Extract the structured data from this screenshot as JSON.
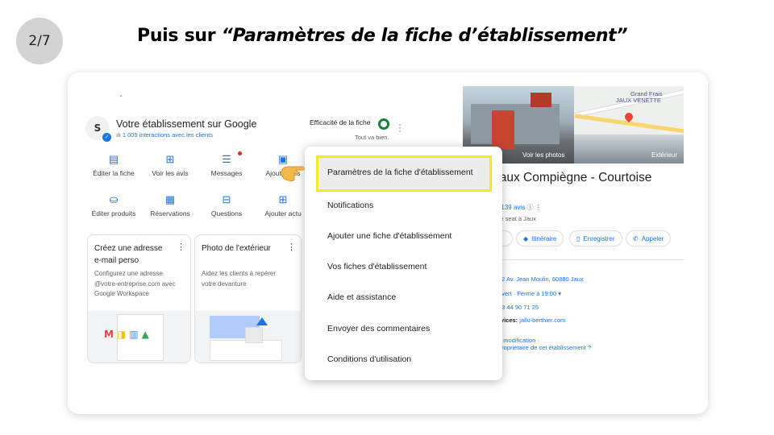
{
  "slide": {
    "step": "2/7",
    "title_prefix": "Puis sur ",
    "title_quoted": "“Paramètres de la fiche d’établissement”"
  },
  "business": {
    "title": "Votre établissement sur Google",
    "interactions": "1 009 interactions avec les clients",
    "efficiency_label": "Efficacité de la fiche",
    "efficiency_status": "Tout va bien."
  },
  "actions": [
    {
      "label": "Éditer la fiche",
      "icon": "storefront-icon"
    },
    {
      "label": "Voir les avis",
      "icon": "review-icon"
    },
    {
      "label": "Messages",
      "icon": "message-icon"
    },
    {
      "label": "Ajouter des",
      "icon": "add-photo-icon"
    },
    {
      "label": "Éditer produits",
      "icon": "shopping-bag-icon"
    },
    {
      "label": "Réservations",
      "icon": "calendar-icon"
    },
    {
      "label": "Questions",
      "icon": "question-icon"
    },
    {
      "label": "Ajouter actu",
      "icon": "add-post-icon"
    }
  ],
  "cards": [
    {
      "title": "Créez une adresse e-mail perso",
      "description": "Configurez une adresse @votre-entreprise.com avec Google Workspace"
    },
    {
      "title": "Photo de l'extérieur",
      "description": "Aidez les clients à repérer votre devanture"
    }
  ],
  "knowledge_panel": {
    "photos_label": "Voir les photos",
    "exterior_label": "Extérieur",
    "map_label_1": "Grand Frais",
    "map_label_2": "JAUX VENETTE",
    "name_line1": "Jaux Compiègne - Courtoise",
    "name_line2": "s",
    "rating_count": "139 avis",
    "type": "aire seat à Jaux",
    "chips": [
      "b",
      "Itinéraire",
      "Enregistrer",
      "Appeler"
    ],
    "address": "12 Av. Jean Moulin, 60880 Jaux",
    "hours": "uvert · Ferme à 19:00 ▾",
    "phone": "03 44 90 71 25",
    "services_label": "rvices:",
    "services_value": "jallu-berthier.com",
    "suggest": "e modification ·",
    "owner": "propriétaire de cet établissement ?"
  },
  "menu": {
    "items": [
      "Paramètres de la fiche d'établissement",
      "Notifications",
      "Ajouter une fiche d'établissement",
      "Vos fiches d'établissement",
      "Aide et assistance",
      "Envoyer des commentaires",
      "Conditions d'utilisation"
    ]
  },
  "colors": {
    "highlight": "#f7ea1f",
    "google_blue": "#1a73e8",
    "efficiency_green": "#188038"
  }
}
